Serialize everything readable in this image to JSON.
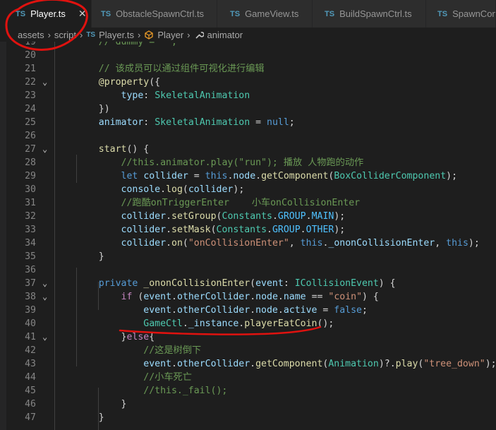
{
  "tabs": [
    {
      "lang": "TS",
      "label": "Player.ts",
      "close": "✕"
    },
    {
      "lang": "TS",
      "label": "ObstacleSpawnCtrl.ts"
    },
    {
      "lang": "TS",
      "label": "GameView.ts"
    },
    {
      "lang": "TS",
      "label": "BuildSpawnCtrl.ts"
    },
    {
      "lang": "TS",
      "label": "SpawnConf"
    }
  ],
  "breadcrumb": {
    "seg1": "assets",
    "seg2": "script",
    "file_lang": "TS",
    "file": "Player.ts",
    "cls": "Player",
    "member": "animator",
    "sep": "›"
  },
  "lines": [
    {
      "n": "19",
      "t": "    // dummy = '';"
    },
    {
      "n": "20",
      "t": ""
    },
    {
      "n": "21",
      "t": "    // 该成员可以通过组件可视化进行编辑"
    },
    {
      "n": "22",
      "t": "    @property({"
    },
    {
      "n": "23",
      "t": "        type: SkeletalAnimation"
    },
    {
      "n": "24",
      "t": "    })"
    },
    {
      "n": "25",
      "t": "    animator: SkeletalAnimation = null;"
    },
    {
      "n": "26",
      "t": ""
    },
    {
      "n": "27",
      "t": "    start() {"
    },
    {
      "n": "28",
      "t": "        //this.animator.play(\"run\"); 播放 人物跑的动作"
    },
    {
      "n": "29",
      "t": "        let collider = this.node.getComponent(BoxColliderComponent);"
    },
    {
      "n": "30",
      "t": "        console.log(collider);"
    },
    {
      "n": "31",
      "t": "        //跑酷onTriggerEnter    小车onCollisionEnter"
    },
    {
      "n": "32",
      "t": "        collider.setGroup(Constants.GROUP.MAIN);"
    },
    {
      "n": "33",
      "t": "        collider.setMask(Constants.GROUP.OTHER);"
    },
    {
      "n": "34",
      "t": "        collider.on(\"onCollisionEnter\", this._ononCollisionEnter, this);"
    },
    {
      "n": "35",
      "t": "    }"
    },
    {
      "n": "36",
      "t": ""
    },
    {
      "n": "37",
      "t": "    private _ononCollisionEnter(event: ICollisionEvent) {"
    },
    {
      "n": "38",
      "t": "        if (event.otherCollider.node.name == \"coin\") {"
    },
    {
      "n": "39",
      "t": "            event.otherCollider.node.active = false;"
    },
    {
      "n": "40",
      "t": "            GameCtl._instance.playerEatCoin();"
    },
    {
      "n": "41",
      "t": "        }else{"
    },
    {
      "n": "42",
      "t": "            //这是树倒下"
    },
    {
      "n": "43",
      "t": "            event.otherCollider.getComponent(Animation)?.play(\"tree_down\");"
    },
    {
      "n": "44",
      "t": "            //小车死亡"
    },
    {
      "n": "45",
      "t": "            //this._fail();"
    },
    {
      "n": "46",
      "t": "        }"
    },
    {
      "n": "47",
      "t": "    }"
    }
  ],
  "colors": {
    "keyword": "#569cd6",
    "control": "#c586c0",
    "function": "#dcdcaa",
    "type": "#4ec9b0",
    "variable": "#9cdcfe",
    "string": "#ce9178",
    "comment": "#6a9955",
    "annotation": "#e0120f"
  }
}
